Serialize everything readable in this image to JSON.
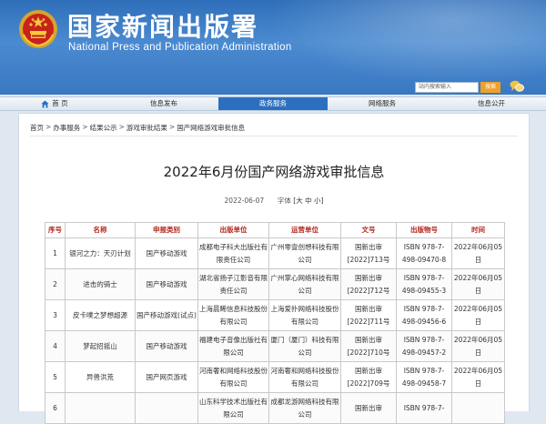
{
  "header": {
    "title_cn": "国家新闻出版署",
    "title_en": "National Press and Publication Administration",
    "search_placeholder": "站内搜索输入",
    "search_button": "搜索",
    "brand_color": "#3a78c2"
  },
  "nav": {
    "items": [
      {
        "label": "首 页",
        "icon": "home-icon"
      },
      {
        "label": "信息发布"
      },
      {
        "label": "政务服务",
        "active": true
      },
      {
        "label": "网络服务"
      },
      {
        "label": "信息公开"
      }
    ]
  },
  "breadcrumb": [
    "首页",
    "办事服务",
    "结果公示",
    "游戏审批结果",
    "国产网络游戏审批信息"
  ],
  "article": {
    "title": "2022年6月份国产网络游戏审批信息",
    "date": "2022-06-07",
    "font_label": "字体",
    "font_sizes": [
      "[大",
      "中",
      "小]"
    ]
  },
  "table": {
    "headers": [
      "序号",
      "名称",
      "申报类别",
      "出版单位",
      "运营单位",
      "文号",
      "出版物号",
      "时间"
    ],
    "rows": [
      [
        "1",
        "银河之力：天刃计划",
        "国产移动游戏",
        "成都电子科大出版社有限责任公司",
        "广州零壹创想科技有限公司",
        "国新出审[2022]713号",
        "ISBN 978-7-498-09470-8",
        "2022年06月05日"
      ],
      [
        "2",
        "进击的骑士",
        "国产移动游戏",
        "湖北省扬子江影音有限责任公司",
        "广州掌心网络科技有限公司",
        "国新出审[2022]712号",
        "ISBN 978-7-498-09455-3",
        "2022年06月05日"
      ],
      [
        "3",
        "皮卡噗之梦想超源",
        "国产移动游戏(试点)",
        "上海晨晞信息科技股份有限公司",
        "上海爱扑网络科技股份有限公司",
        "国新出审[2022]711号",
        "ISBN 978-7-498-09456-6",
        "2022年06月05日"
      ],
      [
        "4",
        "梦起招摇山",
        "国产移动游戏",
        "福建电子音像出版社有限公司",
        "厦门（厦门）科技有限公司",
        "国新出审[2022]710号",
        "ISBN 978-7-498-09457-2",
        "2022年06月05日"
      ],
      [
        "5",
        "异兽洪荒",
        "国产网页游戏",
        "河南奢和网络科技股份有限公司",
        "河南奢和网络科技股份有限公司",
        "国新出审[2022]709号",
        "ISBN 978-7-498-09458-7",
        "2022年06月05日"
      ],
      [
        "6",
        "",
        "",
        "山东科学技术出版社有限公司",
        "成都龙游网络科技有限公司",
        "国新出审",
        "ISBN 978-7-",
        ""
      ]
    ]
  }
}
